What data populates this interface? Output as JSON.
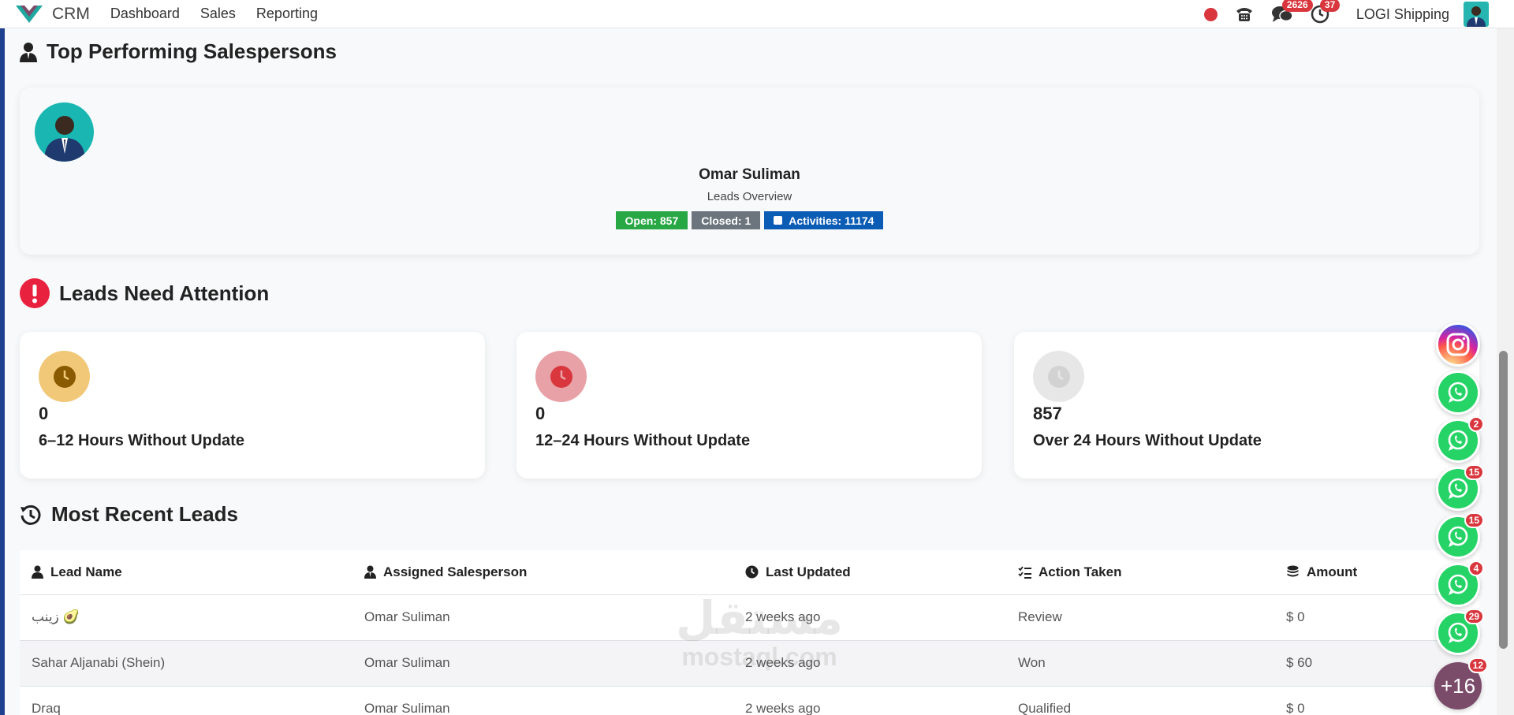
{
  "navbar": {
    "app_name": "CRM",
    "menu": [
      {
        "label": "Dashboard"
      },
      {
        "label": "Sales"
      },
      {
        "label": "Reporting"
      }
    ],
    "messages_count": "2626",
    "activities_count": "37",
    "company": "LOGI Shipping"
  },
  "top_performers": {
    "title": "Top Performing Salespersons",
    "name": "Omar Suliman",
    "subtitle": "Leads Overview",
    "open_label": "Open: 857",
    "closed_label": "Closed: 1",
    "activities_label": "Activities: 11174"
  },
  "attention": {
    "title": "Leads Need Attention",
    "cards": [
      {
        "count": "0",
        "label": "6–12 Hours Without Update",
        "color": "#f0c878",
        "icon_color": "#8a5a00"
      },
      {
        "count": "0",
        "label": "12–24 Hours Without Update",
        "color": "#e8a1a6",
        "icon_color": "#d9363e"
      },
      {
        "count": "857",
        "label": "Over 24 Hours Without Update",
        "color": "#e7e7e7",
        "icon_color": "#cfcfcf"
      }
    ]
  },
  "recent_leads": {
    "title": "Most Recent Leads",
    "columns": [
      "Lead Name",
      "Assigned Salesperson",
      "Last Updated",
      "Action Taken",
      "Amount"
    ],
    "rows": [
      {
        "lead": "زينب 🥑",
        "salesperson": "Omar Suliman",
        "updated": "2 weeks ago",
        "action": "Review",
        "amount": "$ 0"
      },
      {
        "lead": "Sahar Aljanabi (Shein)",
        "salesperson": "Omar Suliman",
        "updated": "2 weeks ago",
        "action": "Won",
        "amount": "$ 60"
      },
      {
        "lead": "Draq",
        "salesperson": "Omar Suliman",
        "updated": "2 weeks ago",
        "action": "Qualified",
        "amount": "$ 0"
      }
    ]
  },
  "floating": {
    "whatsapp_badges": [
      "",
      "2",
      "15",
      "15",
      "4",
      "29"
    ],
    "more_label": "+16",
    "more_badge": "12"
  },
  "watermark": {
    "arabic": "مستقل",
    "latin": "mostaql.com"
  },
  "colors": {
    "accent": "#1f3f8f",
    "success": "#28a745",
    "secondary": "#6c757d",
    "primary": "#0b5cb5",
    "danger": "#d9363e",
    "whatsapp": "#25d366"
  }
}
